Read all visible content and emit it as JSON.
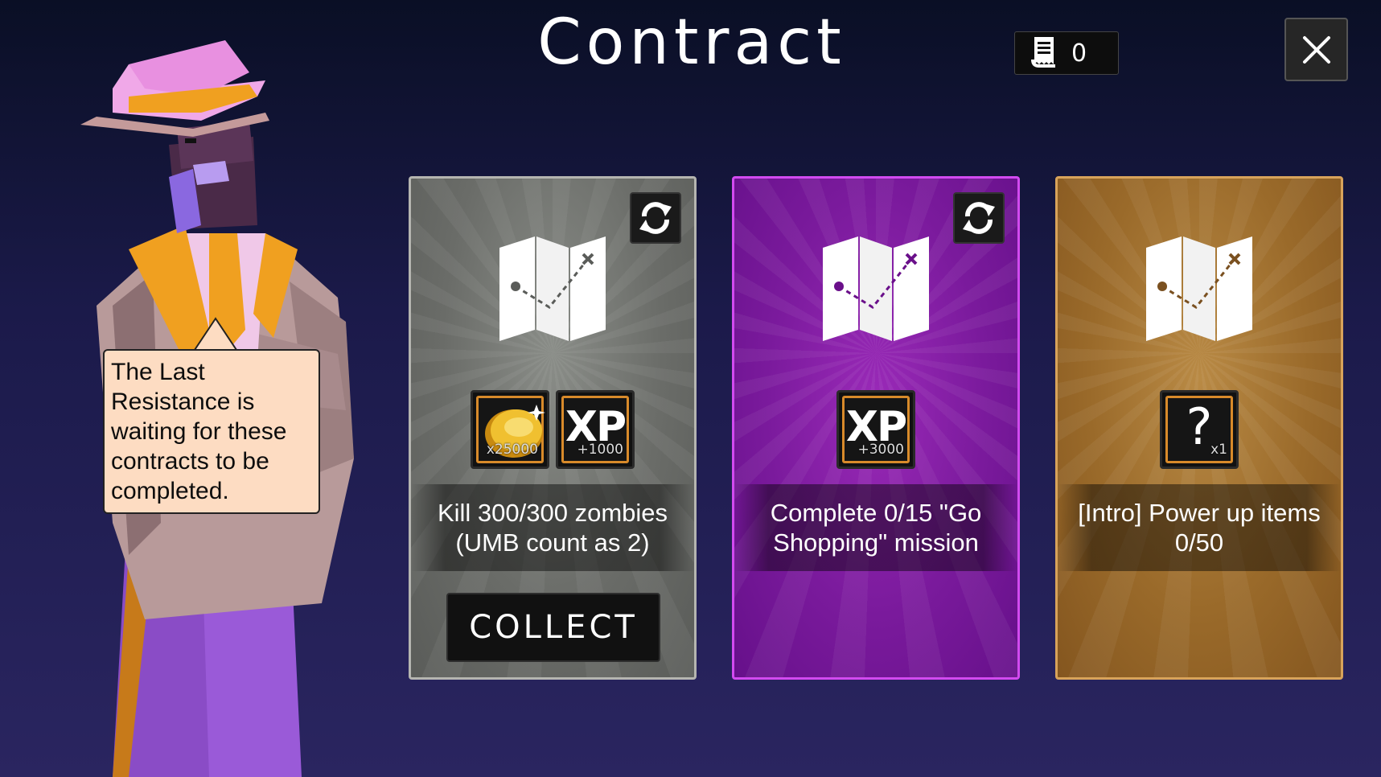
{
  "header": {
    "title": "Contract",
    "ticket_count": "0"
  },
  "npc": {
    "speech": "The Last Resistance is waiting for these contracts to be completed."
  },
  "cards": [
    {
      "rarity": "gray",
      "rewards": [
        {
          "type": "coin",
          "amount": "x25000"
        },
        {
          "type": "xp",
          "label": "XP",
          "amount": "+1000"
        }
      ],
      "description": "Kill 300/300 zombies (UMB count as 2)",
      "button_label": "COLLECT"
    },
    {
      "rarity": "purple",
      "rewards": [
        {
          "type": "xp",
          "label": "XP",
          "amount": "+3000"
        }
      ],
      "description": "Complete 0/15 \"Go Shopping\" mission"
    },
    {
      "rarity": "gold",
      "rewards": [
        {
          "type": "mystery",
          "label": "?",
          "amount": "x1"
        }
      ],
      "description": "[Intro] Power up items 0/50"
    }
  ],
  "colors": {
    "gray_card": "#6a6c68",
    "purple_card": "#7a1a9c",
    "gold_card": "#9a6a2a",
    "reward_border": "#d88a2a"
  },
  "icons": [
    "ticket-icon",
    "close-icon",
    "refresh-icon",
    "map-icon",
    "coin-icon"
  ]
}
